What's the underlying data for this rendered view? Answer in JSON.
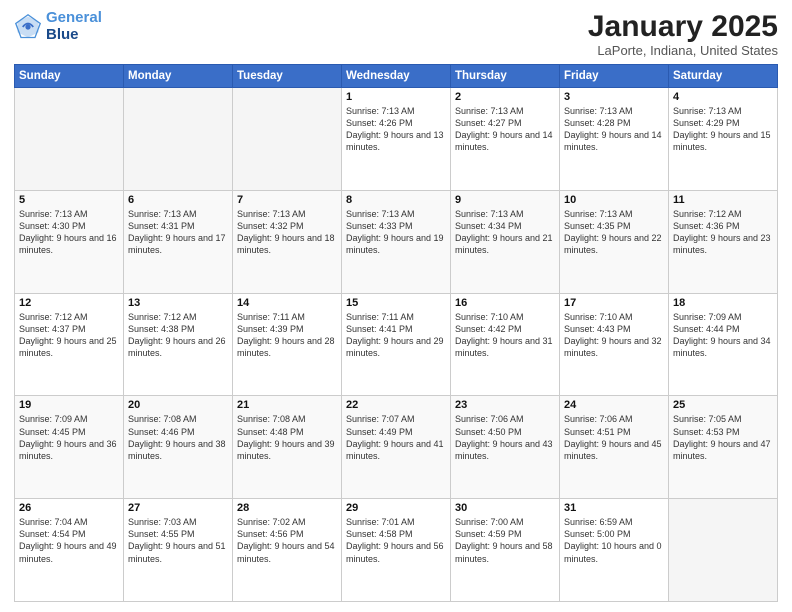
{
  "header": {
    "logo_line1": "General",
    "logo_line2": "Blue",
    "month": "January 2025",
    "location": "LaPorte, Indiana, United States"
  },
  "days_of_week": [
    "Sunday",
    "Monday",
    "Tuesday",
    "Wednesday",
    "Thursday",
    "Friday",
    "Saturday"
  ],
  "weeks": [
    [
      {
        "day": "",
        "empty": true
      },
      {
        "day": "",
        "empty": true
      },
      {
        "day": "",
        "empty": true
      },
      {
        "day": "1",
        "sunrise": "Sunrise: 7:13 AM",
        "sunset": "Sunset: 4:26 PM",
        "daylight": "Daylight: 9 hours and 13 minutes."
      },
      {
        "day": "2",
        "sunrise": "Sunrise: 7:13 AM",
        "sunset": "Sunset: 4:27 PM",
        "daylight": "Daylight: 9 hours and 14 minutes."
      },
      {
        "day": "3",
        "sunrise": "Sunrise: 7:13 AM",
        "sunset": "Sunset: 4:28 PM",
        "daylight": "Daylight: 9 hours and 14 minutes."
      },
      {
        "day": "4",
        "sunrise": "Sunrise: 7:13 AM",
        "sunset": "Sunset: 4:29 PM",
        "daylight": "Daylight: 9 hours and 15 minutes."
      }
    ],
    [
      {
        "day": "5",
        "sunrise": "Sunrise: 7:13 AM",
        "sunset": "Sunset: 4:30 PM",
        "daylight": "Daylight: 9 hours and 16 minutes."
      },
      {
        "day": "6",
        "sunrise": "Sunrise: 7:13 AM",
        "sunset": "Sunset: 4:31 PM",
        "daylight": "Daylight: 9 hours and 17 minutes."
      },
      {
        "day": "7",
        "sunrise": "Sunrise: 7:13 AM",
        "sunset": "Sunset: 4:32 PM",
        "daylight": "Daylight: 9 hours and 18 minutes."
      },
      {
        "day": "8",
        "sunrise": "Sunrise: 7:13 AM",
        "sunset": "Sunset: 4:33 PM",
        "daylight": "Daylight: 9 hours and 19 minutes."
      },
      {
        "day": "9",
        "sunrise": "Sunrise: 7:13 AM",
        "sunset": "Sunset: 4:34 PM",
        "daylight": "Daylight: 9 hours and 21 minutes."
      },
      {
        "day": "10",
        "sunrise": "Sunrise: 7:13 AM",
        "sunset": "Sunset: 4:35 PM",
        "daylight": "Daylight: 9 hours and 22 minutes."
      },
      {
        "day": "11",
        "sunrise": "Sunrise: 7:12 AM",
        "sunset": "Sunset: 4:36 PM",
        "daylight": "Daylight: 9 hours and 23 minutes."
      }
    ],
    [
      {
        "day": "12",
        "sunrise": "Sunrise: 7:12 AM",
        "sunset": "Sunset: 4:37 PM",
        "daylight": "Daylight: 9 hours and 25 minutes."
      },
      {
        "day": "13",
        "sunrise": "Sunrise: 7:12 AM",
        "sunset": "Sunset: 4:38 PM",
        "daylight": "Daylight: 9 hours and 26 minutes."
      },
      {
        "day": "14",
        "sunrise": "Sunrise: 7:11 AM",
        "sunset": "Sunset: 4:39 PM",
        "daylight": "Daylight: 9 hours and 28 minutes."
      },
      {
        "day": "15",
        "sunrise": "Sunrise: 7:11 AM",
        "sunset": "Sunset: 4:41 PM",
        "daylight": "Daylight: 9 hours and 29 minutes."
      },
      {
        "day": "16",
        "sunrise": "Sunrise: 7:10 AM",
        "sunset": "Sunset: 4:42 PM",
        "daylight": "Daylight: 9 hours and 31 minutes."
      },
      {
        "day": "17",
        "sunrise": "Sunrise: 7:10 AM",
        "sunset": "Sunset: 4:43 PM",
        "daylight": "Daylight: 9 hours and 32 minutes."
      },
      {
        "day": "18",
        "sunrise": "Sunrise: 7:09 AM",
        "sunset": "Sunset: 4:44 PM",
        "daylight": "Daylight: 9 hours and 34 minutes."
      }
    ],
    [
      {
        "day": "19",
        "sunrise": "Sunrise: 7:09 AM",
        "sunset": "Sunset: 4:45 PM",
        "daylight": "Daylight: 9 hours and 36 minutes."
      },
      {
        "day": "20",
        "sunrise": "Sunrise: 7:08 AM",
        "sunset": "Sunset: 4:46 PM",
        "daylight": "Daylight: 9 hours and 38 minutes."
      },
      {
        "day": "21",
        "sunrise": "Sunrise: 7:08 AM",
        "sunset": "Sunset: 4:48 PM",
        "daylight": "Daylight: 9 hours and 39 minutes."
      },
      {
        "day": "22",
        "sunrise": "Sunrise: 7:07 AM",
        "sunset": "Sunset: 4:49 PM",
        "daylight": "Daylight: 9 hours and 41 minutes."
      },
      {
        "day": "23",
        "sunrise": "Sunrise: 7:06 AM",
        "sunset": "Sunset: 4:50 PM",
        "daylight": "Daylight: 9 hours and 43 minutes."
      },
      {
        "day": "24",
        "sunrise": "Sunrise: 7:06 AM",
        "sunset": "Sunset: 4:51 PM",
        "daylight": "Daylight: 9 hours and 45 minutes."
      },
      {
        "day": "25",
        "sunrise": "Sunrise: 7:05 AM",
        "sunset": "Sunset: 4:53 PM",
        "daylight": "Daylight: 9 hours and 47 minutes."
      }
    ],
    [
      {
        "day": "26",
        "sunrise": "Sunrise: 7:04 AM",
        "sunset": "Sunset: 4:54 PM",
        "daylight": "Daylight: 9 hours and 49 minutes."
      },
      {
        "day": "27",
        "sunrise": "Sunrise: 7:03 AM",
        "sunset": "Sunset: 4:55 PM",
        "daylight": "Daylight: 9 hours and 51 minutes."
      },
      {
        "day": "28",
        "sunrise": "Sunrise: 7:02 AM",
        "sunset": "Sunset: 4:56 PM",
        "daylight": "Daylight: 9 hours and 54 minutes."
      },
      {
        "day": "29",
        "sunrise": "Sunrise: 7:01 AM",
        "sunset": "Sunset: 4:58 PM",
        "daylight": "Daylight: 9 hours and 56 minutes."
      },
      {
        "day": "30",
        "sunrise": "Sunrise: 7:00 AM",
        "sunset": "Sunset: 4:59 PM",
        "daylight": "Daylight: 9 hours and 58 minutes."
      },
      {
        "day": "31",
        "sunrise": "Sunrise: 6:59 AM",
        "sunset": "Sunset: 5:00 PM",
        "daylight": "Daylight: 10 hours and 0 minutes."
      },
      {
        "day": "",
        "empty": true
      }
    ]
  ]
}
